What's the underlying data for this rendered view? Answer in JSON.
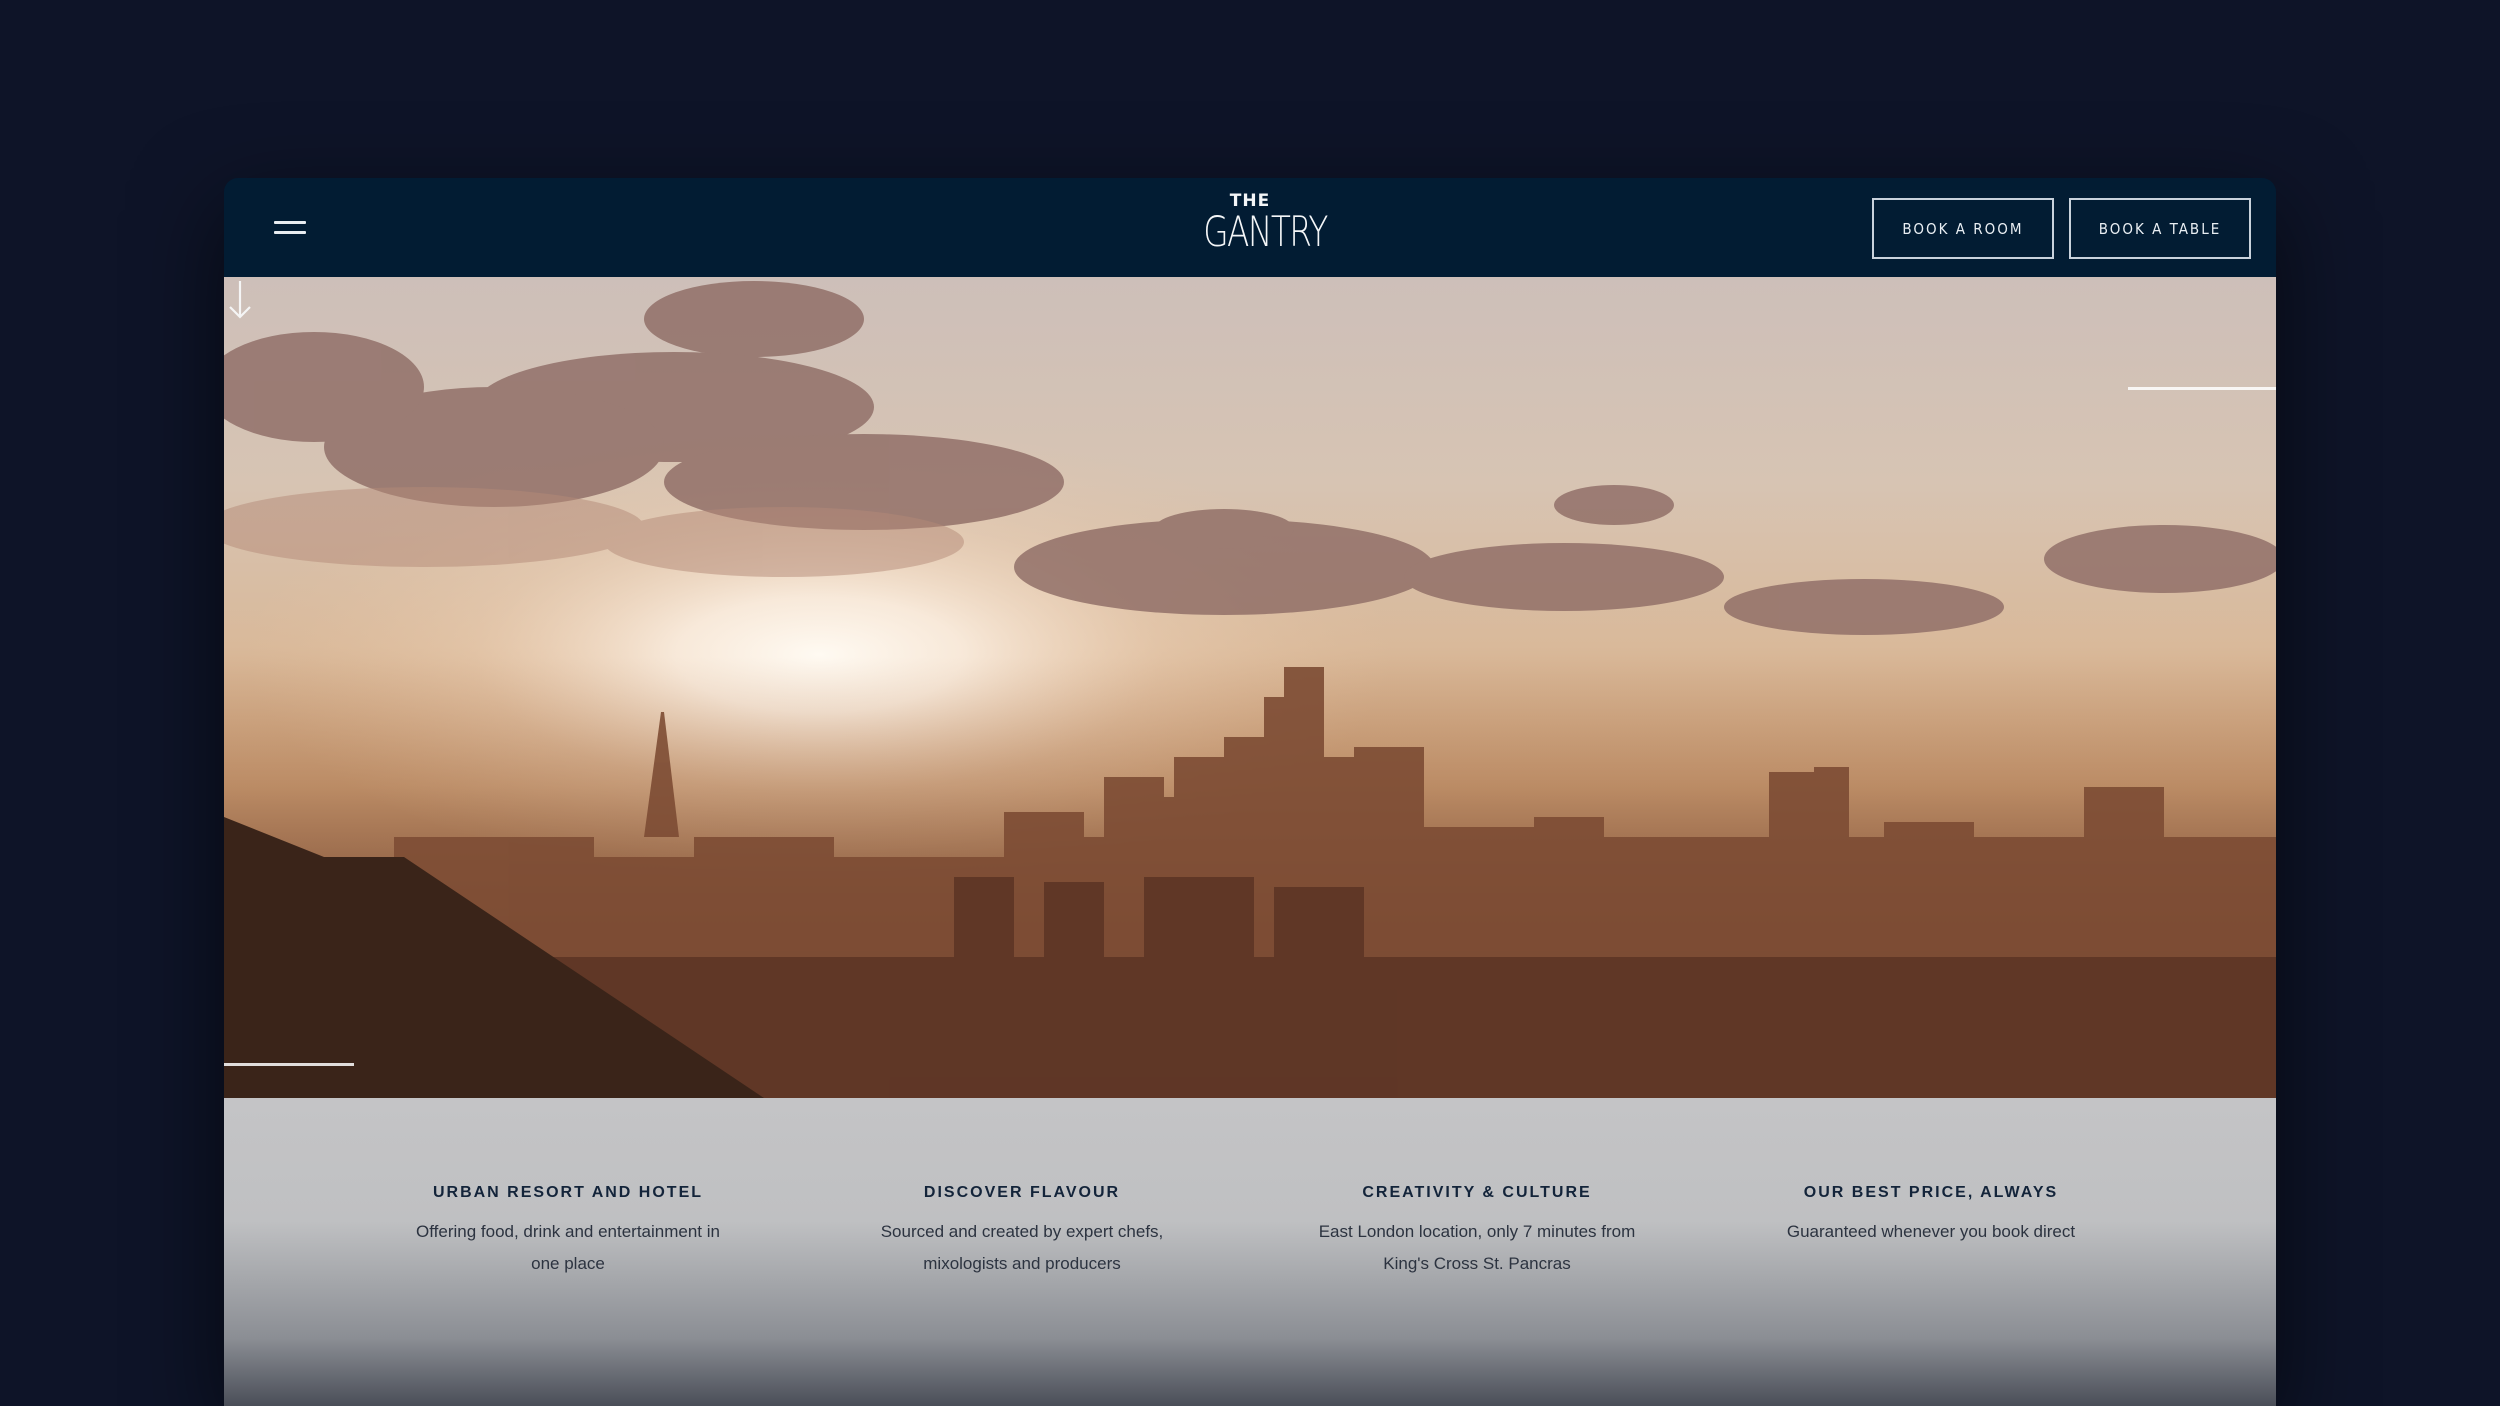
{
  "header": {
    "logo_top": "THE",
    "logo_name": "GANTRY",
    "book_room_label": "BOOK A ROOM",
    "book_table_label": "BOOK A TABLE"
  },
  "hero": {
    "icons": {
      "menu": "hamburger-menu-icon",
      "scroll": "arrow-down-icon"
    }
  },
  "features": [
    {
      "title": "URBAN RESORT AND HOTEL",
      "line1": "Offering food, drink and entertainment in",
      "line2": "one place"
    },
    {
      "title": "DISCOVER FLAVOUR",
      "line1": "Sourced and created by expert chefs,",
      "line2": "mixologists and producers"
    },
    {
      "title": "CREATIVITY & CULTURE",
      "line1": "East London location, only 7 minutes from",
      "line2": "King's Cross St. Pancras"
    },
    {
      "title": "OUR BEST PRICE, ALWAYS",
      "line1": "Guaranteed whenever you book direct",
      "line2": ""
    }
  ],
  "colors": {
    "page_background": "#0e1428",
    "header_background": "#021c33",
    "feature_title": "#13243a"
  }
}
